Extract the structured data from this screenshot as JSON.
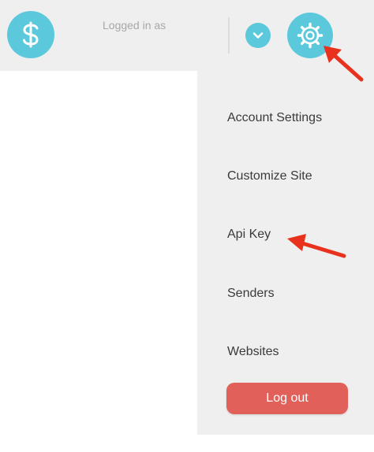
{
  "header": {
    "logged_in_text": "Logged in as",
    "billing_icon": "dollar-icon",
    "dropdown_icon": "chevron-down-icon",
    "settings_icon": "gear-icon"
  },
  "menu": {
    "items": [
      {
        "label": "Account Settings"
      },
      {
        "label": "Customize Site"
      },
      {
        "label": "Api Key"
      },
      {
        "label": "Senders"
      },
      {
        "label": "Websites"
      }
    ],
    "logout_label": "Log out"
  },
  "colors": {
    "accent": "#5bc8dc",
    "logout": "#e2605a",
    "annotation_arrow": "#e8321e",
    "panel_bg": "#efefef"
  }
}
